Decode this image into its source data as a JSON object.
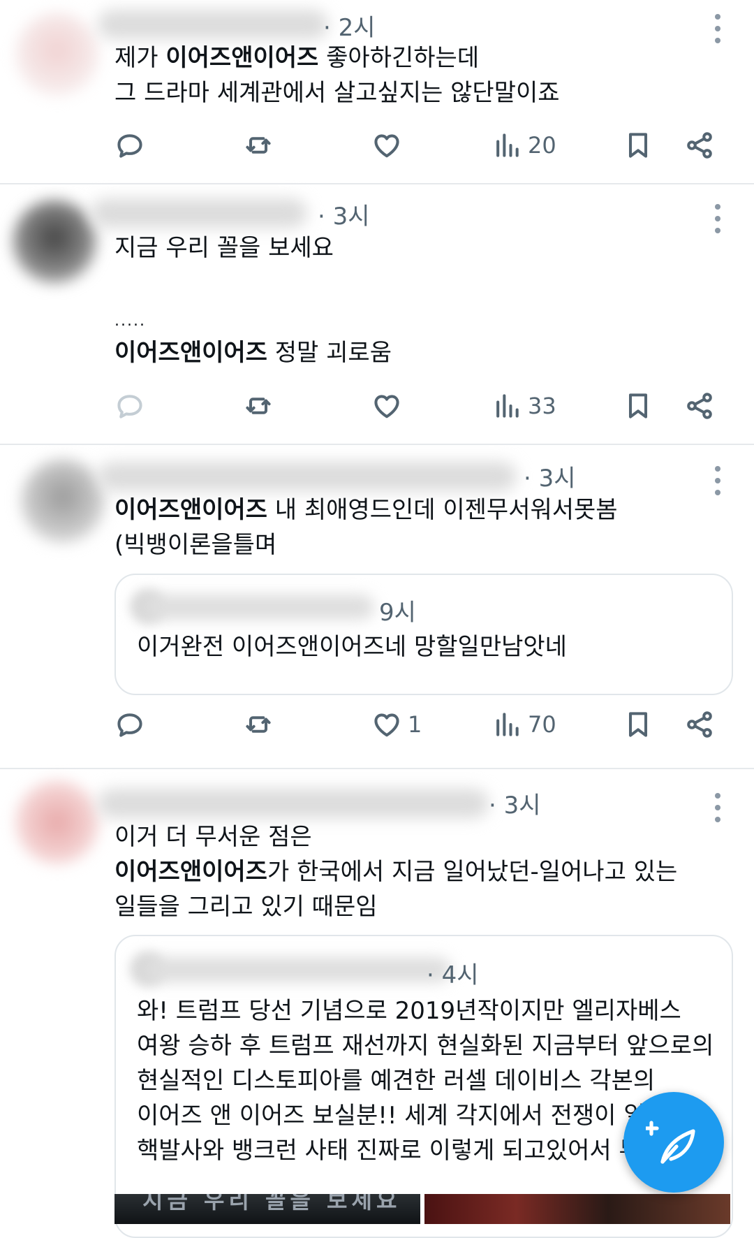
{
  "posts": [
    {
      "time": "· 2시",
      "lines": [
        {
          "bold": "",
          "pre": "제가 ",
          "b": "이어즈앤이어즈",
          "post": " 좋아하긴하는데"
        },
        {
          "pre": "그 드라마 세계관에서 살고싶지는 않단말이죠",
          "b": "",
          "post": ""
        }
      ],
      "views": "20",
      "likes": ""
    },
    {
      "time": "· 3시",
      "lines": [
        {
          "pre": "지금 우리 꼴을 보세요",
          "b": "",
          "post": ""
        },
        {
          "pre": "",
          "b": "",
          "post": ""
        },
        {
          "pre": ".....",
          "b": "",
          "post": ""
        },
        {
          "pre": "",
          "b": "이어즈앤이어즈",
          "post": " 정말 괴로움"
        }
      ],
      "views": "33",
      "likes": ""
    },
    {
      "time": "· 3시",
      "lines": [
        {
          "pre": "",
          "b": "이어즈앤이어즈",
          "post": " 내 최애영드인데 이젠무서워서못봄"
        },
        {
          "pre": "(빅뱅이론을틀며",
          "b": "",
          "post": ""
        }
      ],
      "quote": {
        "time": "9시",
        "text": "이거완전 이어즈앤이어즈네 망할일만남앗네"
      },
      "views": "70",
      "likes": "1"
    },
    {
      "time": "· 3시",
      "lines": [
        {
          "pre": "이거 더 무서운 점은",
          "b": "",
          "post": ""
        },
        {
          "pre": "",
          "b": "이어즈앤이어즈",
          "post": "가 한국에서 지금 일어났던-일어나고 있는"
        },
        {
          "pre": "일들을 그리고 있기 때문임",
          "b": "",
          "post": ""
        }
      ],
      "quote": {
        "time": "· 4시",
        "lines": [
          "와! 트럼프 당선 기념으로 2019년작이지만 엘리자베스",
          "여왕 승하 후 트럼프 재선까지 현실화된 지금부터 앞으로의",
          "현실적인 디스토피아를 예견한 러셀 데이비스 각본의",
          "이어즈 앤 이어즈 보실분!! 세계 각지에서 전쟁이 일",
          "핵발사와 뱅크런 사태 진짜로 이렇게 되고있어서 무"
        ],
        "image_caption": "지금 우리 꼴을 보세요"
      }
    }
  ],
  "icons": {
    "reply": "reply-icon",
    "repost": "repost-icon",
    "like": "heart-icon",
    "views": "views-icon",
    "bookmark": "bookmark-icon",
    "share": "share-icon",
    "compose": "compose-icon"
  },
  "colors": {
    "accent": "#1d9bf0",
    "muted": "#536471",
    "divider": "#e6e9ec"
  }
}
